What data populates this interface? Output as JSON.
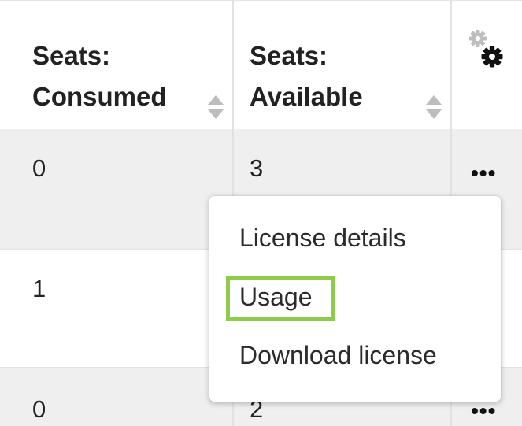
{
  "table": {
    "headers": {
      "consumed_line1": "Seats:",
      "consumed_line2": "Consumed",
      "available_line1": "Seats:",
      "available_line2": "Available"
    },
    "rows": [
      {
        "consumed": "0",
        "available": "3",
        "actions": "•••"
      },
      {
        "consumed": "1",
        "available": "",
        "actions": ""
      },
      {
        "consumed": "0",
        "available": "2",
        "actions": "•••"
      }
    ]
  },
  "menu": {
    "items": [
      {
        "label": "License details"
      },
      {
        "label": "Usage",
        "highlighted": true
      },
      {
        "label": "Download license"
      }
    ]
  },
  "colors": {
    "highlight": "#8fcb4a",
    "row_shaded": "#efefef",
    "sort_icon": "#bdbdbd",
    "gear_small": "#bdbdbd",
    "gear_large": "#111111"
  },
  "icons": {
    "sort": "sort-icon",
    "column_settings": "gear-icon",
    "row_actions": "more-horizontal-icon"
  }
}
